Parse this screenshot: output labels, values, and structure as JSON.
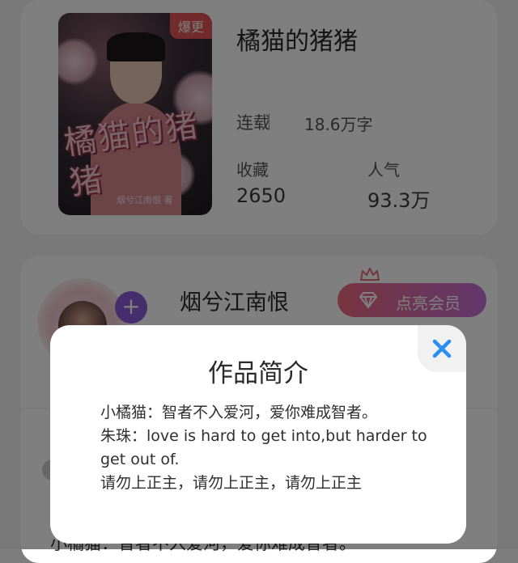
{
  "book": {
    "badge": "爆更",
    "title": "橘猫的猪猪",
    "cover_title": "橘猫的猪猪",
    "cover_author": "烟兮江南恨 著",
    "status": "连载",
    "word_count": "18.6万字",
    "stats": [
      {
        "label": "收藏",
        "value": "2650"
      },
      {
        "label": "人气",
        "value": "93.3万"
      }
    ]
  },
  "author": {
    "name": "烟兮江南恨",
    "follow_label": "+",
    "vip_label": "点亮会员"
  },
  "background_intro": "小橘猫：智者不入爱河，爱你难成智者。",
  "modal": {
    "title": "作品简介",
    "lines": [
      "小橘猫：智者不入爱河，爱你难成智者。",
      "朱珠：love is hard to get into,but harder to get  out of.",
      "请勿上正主，请勿上正主，请勿上正主"
    ]
  },
  "colors": {
    "badge": "#e25656",
    "close": "#2a8ff0",
    "vip_gradient_start": "#f06a7e",
    "vip_gradient_end": "#c46fd9",
    "follow": "#8d5cd8"
  },
  "icons": {
    "close": "close-icon",
    "crown": "crown-icon",
    "gem": "diamond-icon"
  }
}
